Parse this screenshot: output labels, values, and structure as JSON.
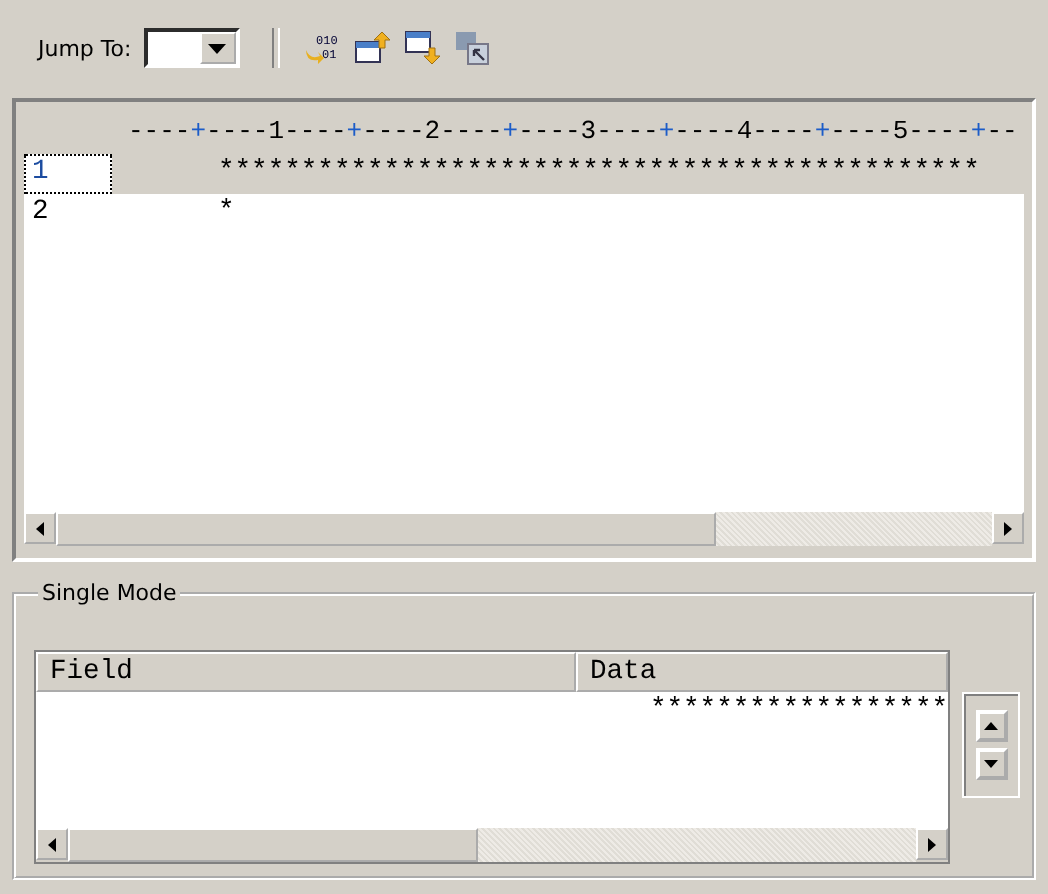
{
  "toolbar": {
    "jump_label": "Jump To:",
    "binary_icon_text": [
      "010",
      "01"
    ]
  },
  "ruler": [
    {
      "text": "----",
      "kind": "dashes"
    },
    {
      "text": "+",
      "kind": "tick"
    },
    {
      "text": "----1----",
      "kind": "dashes"
    },
    {
      "text": "+",
      "kind": "tick"
    },
    {
      "text": "----2----",
      "kind": "dashes"
    },
    {
      "text": "+",
      "kind": "tick"
    },
    {
      "text": "----3----",
      "kind": "dashes"
    },
    {
      "text": "+",
      "kind": "tick"
    },
    {
      "text": "----4----",
      "kind": "dashes"
    },
    {
      "text": "+",
      "kind": "tick"
    },
    {
      "text": "----5----",
      "kind": "dashes"
    },
    {
      "text": "+",
      "kind": "tick"
    },
    {
      "text": "--",
      "kind": "dashes"
    }
  ],
  "rows": [
    {
      "number": "1",
      "content": "**********************************************",
      "selected": true
    },
    {
      "number": "2",
      "content": "*",
      "selected": false
    }
  ],
  "single_mode": {
    "title": "Single Mode",
    "columns": [
      "Field",
      "Data"
    ],
    "rows": [
      {
        "field": "",
        "data": "******************"
      }
    ]
  }
}
